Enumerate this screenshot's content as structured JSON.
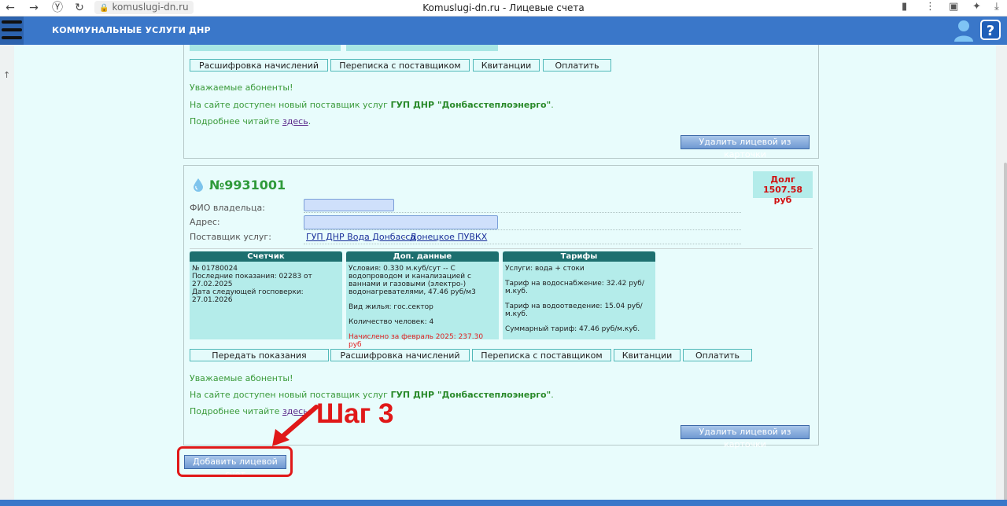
{
  "browser": {
    "url": "komuslugi-dn.ru",
    "tab_title": "Komuslugi-dn.ru - Лицевые счета"
  },
  "header": {
    "title": "КОММУНАЛЬНЫЕ УСЛУГИ ДНР",
    "help_label": "?"
  },
  "top_card": {
    "buttons": [
      "Расшифровка начислений",
      "Переписка с поставщиком",
      "Квитанции",
      "Оплатить"
    ],
    "notice_greeting": "Уважаемые абоненты!",
    "notice_text": "На сайте доступен новый поставщик услуг",
    "notice_provider": "ГУП ДНР \"Донбасстеплоэнерго\"",
    "notice_dot": ".",
    "notice_more": "Подробнее читайте",
    "notice_link": "здесь",
    "remove_button": "Удалить лицевой из карточки"
  },
  "account": {
    "number": "№9931001",
    "debt_label": "Долг",
    "debt_value": "1507.58 руб",
    "owner_label": "ФИО владельца:",
    "address_label": "Адрес:",
    "provider_label": "Поставщик услуг:",
    "provider_name": "ГУП ДНР Вода Донбасса",
    "provider_sep": "-",
    "provider_branch": "Донецкое ПУВКХ"
  },
  "panels": {
    "meter": {
      "title": "Счетчик",
      "lines": [
        "№ 01780024",
        "Последние показания: 02283 от 27.02.2025",
        "Дата следующей госповерки: 27.01.2026"
      ]
    },
    "extra": {
      "title": "Доп. данные",
      "conditions": "Условия: 0.330 м.куб/сут -- С водопроводом и канализацией с ваннами и газовыми (электро-) водонагревателями, 47.46 руб/м3",
      "housing": "Вид жилья: гос.сектор",
      "people": "Количество человек: 4",
      "accrued": "Начислено за февраль 2025: 237.30 руб"
    },
    "tariffs": {
      "title": "Тарифы",
      "services": "Услуги: вода + стоки",
      "water_supply": "Тариф на водоснабжение: 32.42 руб/м.куб.",
      "water_disposal": "Тариф на водоотведение: 15.04 руб/м.куб.",
      "total": "Суммарный тариф: 47.46 руб/м.куб."
    }
  },
  "account_buttons": [
    "Передать показания",
    "Расшифровка начислений",
    "Переписка с поставщиком",
    "Квитанции",
    "Оплатить"
  ],
  "add_account_button": "Добавить лицевой счет",
  "annotation": {
    "step_label": "Шаг 3",
    "color": "#e01818"
  },
  "colors": {
    "header_bg": "#3a77c9",
    "page_bg": "#e8fcfc",
    "panel_head": "#1d6f6f",
    "accent_green": "#2f9a3a",
    "debt_red": "#d01010"
  }
}
